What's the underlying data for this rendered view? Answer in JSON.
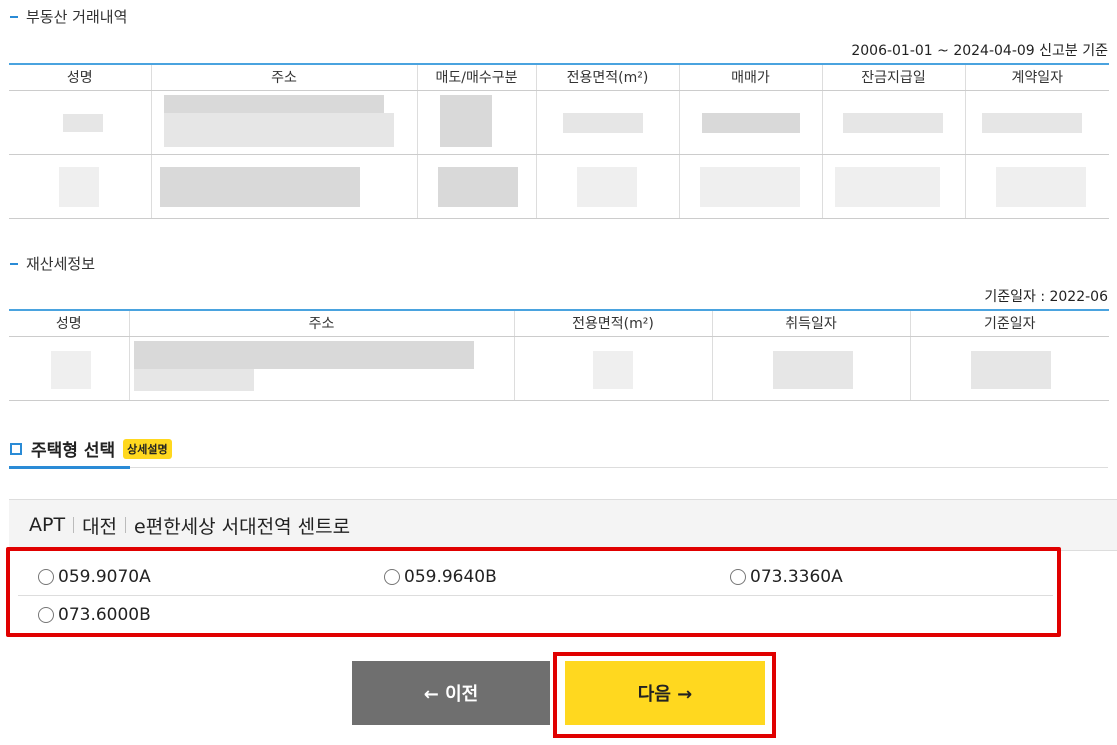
{
  "realestate": {
    "title": "부동산 거래내역",
    "period_note": "2006-01-01 ~ 2024-04-09 신고분 기준",
    "columns": [
      "성명",
      "주소",
      "매도/매수구분",
      "전용면적(m²)",
      "매매가",
      "잔금지급일",
      "계약일자"
    ]
  },
  "property_tax": {
    "title": "재산세정보",
    "base_note": "기준일자 : 2022-06",
    "columns": [
      "성명",
      "주소",
      "전용면적(m²)",
      "취득일자",
      "기준일자"
    ]
  },
  "house_type": {
    "title": "주택형 선택",
    "detail_badge": "상세설명"
  },
  "complex": {
    "type": "APT",
    "region": "대전",
    "name": "e편한세상 서대전역 센트로"
  },
  "options": [
    "059.9070A",
    "059.9640B",
    "073.3360A",
    "073.6000B"
  ],
  "buttons": {
    "prev": "← 이전",
    "next": "다음 →"
  },
  "colors": {
    "accent_blue": "#2a8bd6",
    "highlight_red": "#e00000",
    "next_yellow": "#ffd81f",
    "prev_gray": "#6f6f6f"
  }
}
